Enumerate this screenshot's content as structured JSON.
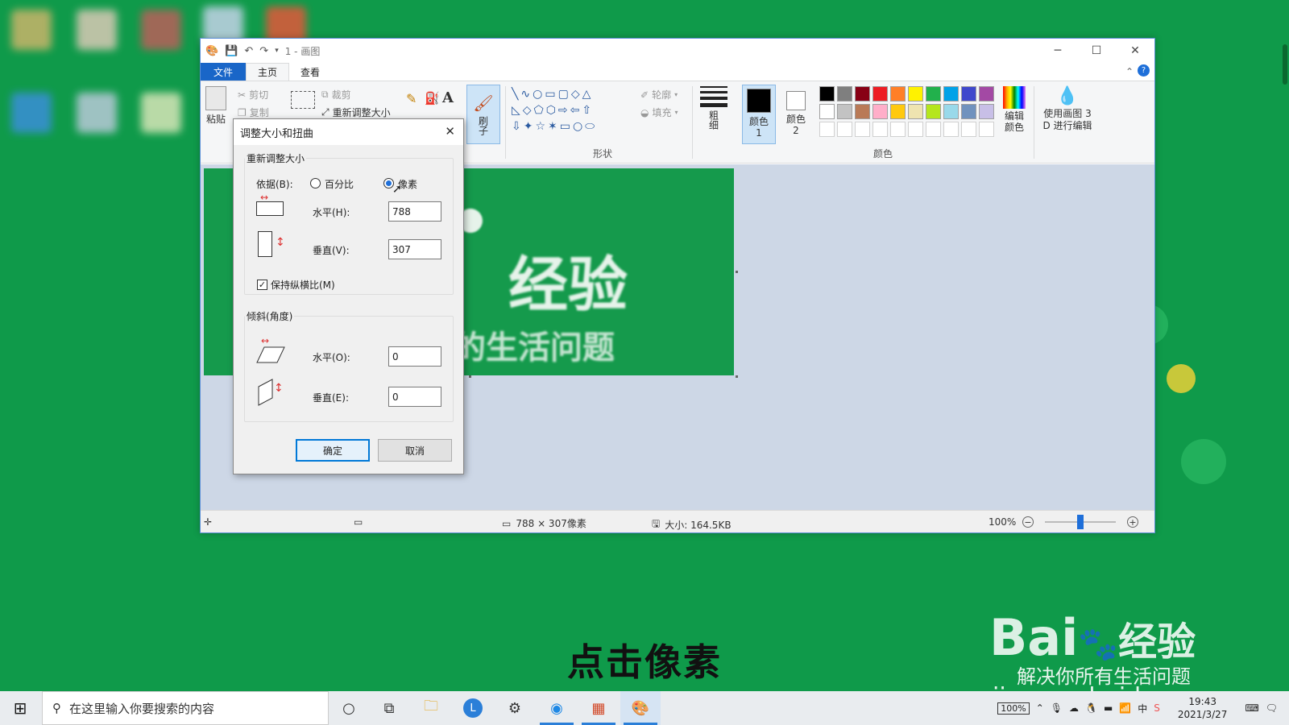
{
  "window": {
    "title": "1 - 画图",
    "tabs": [
      "文件",
      "主页",
      "查看"
    ]
  },
  "ribbon": {
    "paste": "粘贴",
    "cut": "剪切",
    "copy": "复制",
    "crop": "裁剪",
    "resize": "重新调整大小",
    "brush": "刷子",
    "outline": "轮廓",
    "fill": "填充",
    "shapes_label": "形状",
    "size": "粗细",
    "color1": "颜色 1",
    "color2": "颜色 2",
    "edit_colors": "编辑颜色",
    "paint3d": "使用画图 3 D 进行编辑",
    "colors_label": "颜色",
    "palette_row1": [
      "#000000",
      "#7f7f7f",
      "#880015",
      "#ed1c24",
      "#ff7f27",
      "#fff200",
      "#22b14c",
      "#00a2e8",
      "#3f48cc",
      "#a349a4"
    ],
    "palette_row2": [
      "#ffffff",
      "#c3c3c3",
      "#b97a57",
      "#ffaec9",
      "#ffc90e",
      "#efe4b0",
      "#b5e61d",
      "#99d9ea",
      "#7092be",
      "#c8bfe7"
    ]
  },
  "canvas": {
    "image_text_1": "经验",
    "image_text_2": "的生活问题"
  },
  "dialog": {
    "title": "调整大小和扭曲",
    "resize_group": "重新调整大小",
    "by_label": "依据(B):",
    "percent": "百分比",
    "pixels": "像素",
    "horizontal_label": "水平(H):",
    "horizontal_value": "788",
    "vertical_label": "垂直(V):",
    "vertical_value": "307",
    "keep_ratio": "保持纵横比(M)",
    "skew_group": "倾斜(角度)",
    "skew_h_label": "水平(O):",
    "skew_h_value": "0",
    "skew_v_label": "垂直(E):",
    "skew_v_value": "0",
    "ok": "确定",
    "cancel": "取消"
  },
  "status": {
    "dimensions": "788 × 307像素",
    "size": "大小: 164.5KB",
    "zoom": "100%"
  },
  "subtitle": "点击像素",
  "watermark": {
    "brand": "Bai",
    "brand2": "经验",
    "slogan": "解决你所有生活问题",
    "url": "jingyan.baidu.com"
  },
  "taskbar": {
    "search_placeholder": "在这里输入你要搜索的内容",
    "battery": "100%",
    "time": "19:43",
    "date": "2021/3/27"
  },
  "colors": {
    "desktop": "#0f9a4a",
    "accent": "#1966c8"
  }
}
